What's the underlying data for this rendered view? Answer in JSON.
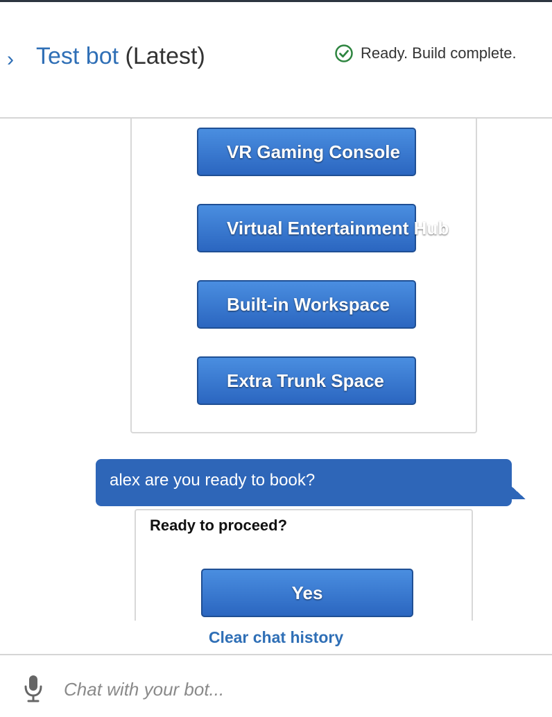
{
  "header": {
    "chevron": "›",
    "title_name": "Test bot",
    "title_version": "(Latest)",
    "status_text": "Ready. Build complete.",
    "status_icon": "check-circle-icon",
    "status_color": "#2e8540"
  },
  "conversation": {
    "options_card": {
      "options": [
        {
          "label": "VR Gaming Console"
        },
        {
          "label": "Virtual Entertainment Hub"
        },
        {
          "label": "Built-in Workspace"
        },
        {
          "label": "Extra Trunk Space"
        }
      ]
    },
    "bot_message": "alex are you ready to book?",
    "confirm_card": {
      "title": "Ready to proceed?",
      "yes_label": "Yes"
    }
  },
  "footer": {
    "clear_label": "Clear chat history",
    "mic_icon": "microphone-icon",
    "input_placeholder": "Chat with your bot...",
    "input_value": ""
  },
  "colors": {
    "accent": "#2f6fb6",
    "button_top": "#4a8ee0",
    "button_bottom": "#2b66c0",
    "bubble": "#2e66b8"
  }
}
